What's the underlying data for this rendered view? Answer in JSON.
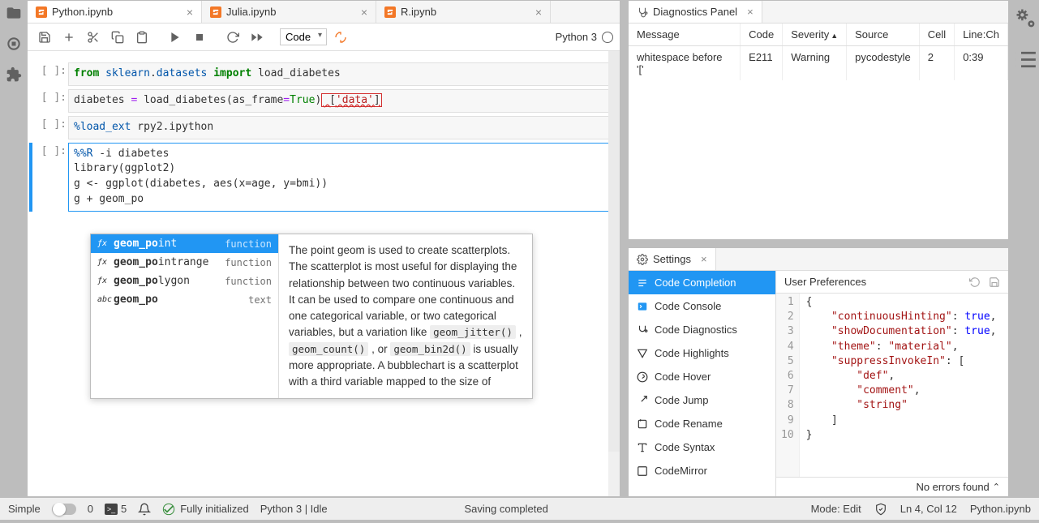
{
  "tabs": [
    {
      "label": "Python.ipynb",
      "active": true
    },
    {
      "label": "Julia.ipynb",
      "active": false
    },
    {
      "label": "R.ipynb",
      "active": false
    }
  ],
  "toolbar": {
    "cell_type": "Code",
    "kernel_name": "Python 3"
  },
  "cells": [
    {
      "prompt": "[ ]:"
    },
    {
      "prompt": "[ ]:"
    },
    {
      "prompt": "[ ]:"
    },
    {
      "prompt": "[ ]:"
    }
  ],
  "code_tokens": {
    "c1_from": "from",
    "c1_sklearn": "sklearn",
    "c1_dot": ".",
    "c1_datasets": "datasets",
    "c1_import": "import",
    "c1_load": "load_diabetes",
    "c2_lhs": "diabetes ",
    "c2_eq": "=",
    "c2_call": " load_diabetes(as_frame",
    "c2_eq2": "=",
    "c2_true": "True",
    "c2_close": ")",
    "c2_err": " [",
    "c2_str": "'data'",
    "c2_err2": "]",
    "c3_magic": "%load_ext",
    "c3_rest": " rpy2.ipython",
    "c4_line1_magic": "%%R",
    "c4_line1_rest": " -i diabetes",
    "c4_line2": "library(ggplot2)",
    "c4_line3": "g <- ggplot(diabetes, aes(x=age, y=bmi))",
    "c4_line4": "g + geom_po"
  },
  "completion": {
    "items": [
      {
        "icon": "ƒx",
        "prefix": "geom_po",
        "rest": "int",
        "type": "function",
        "selected": true
      },
      {
        "icon": "ƒx",
        "prefix": "geom_po",
        "rest": "intrange",
        "type": "function"
      },
      {
        "icon": "ƒx",
        "prefix": "geom_po",
        "rest": "lygon",
        "type": "function"
      },
      {
        "icon": "abc",
        "prefix": "geom_po",
        "rest": "",
        "type": "text"
      }
    ],
    "doc_pre": "The point geom is used to create scatterplots. The scatterplot is most useful for displaying the relationship between two continuous variables. It can be used to compare one continuous and one categorical variable, or two categorical variables, but a variation like ",
    "doc_c1": "geom_jitter()",
    "doc_s1": " , ",
    "doc_c2": "geom_count()",
    "doc_s2": " , or ",
    "doc_c3": "geom_bin2d()",
    "doc_post": " is usually more appropriate. A bubblechart is a scatterplot with a third variable mapped to the size of"
  },
  "diagnostics": {
    "title": "Diagnostics Panel",
    "headers": {
      "message": "Message",
      "code": "Code",
      "severity": "Severity",
      "source": "Source",
      "cell": "Cell",
      "linech": "Line:Ch"
    },
    "rows": [
      {
        "message": "whitespace before '['",
        "code": "E211",
        "severity": "Warning",
        "source": "pycodestyle",
        "cell": "2",
        "linech": "0:39"
      }
    ]
  },
  "settings": {
    "title": "Settings",
    "nav": [
      {
        "label": "Code Completion",
        "active": true
      },
      {
        "label": "Code Console"
      },
      {
        "label": "Code Diagnostics"
      },
      {
        "label": "Code Highlights"
      },
      {
        "label": "Code Hover"
      },
      {
        "label": "Code Jump"
      },
      {
        "label": "Code Rename"
      },
      {
        "label": "Code Syntax"
      },
      {
        "label": "CodeMirror"
      }
    ],
    "editor_title": "User Preferences",
    "json_lines": [
      "{",
      "    \"continuousHinting\": true,",
      "    \"showDocumentation\": true,",
      "    \"theme\": \"material\",",
      "    \"suppressInvokeIn\": [",
      "        \"def\",",
      "        \"comment\",",
      "        \"string\"",
      "    ]",
      "}"
    ],
    "footer": "No errors found"
  },
  "statusbar": {
    "simple": "Simple",
    "count1": "0",
    "count2": "5",
    "lsp": "Fully initialized",
    "kernel": "Python 3 | Idle",
    "saving": "Saving completed",
    "mode": "Mode: Edit",
    "cursor": "Ln 4, Col 12",
    "file": "Python.ipynb"
  }
}
